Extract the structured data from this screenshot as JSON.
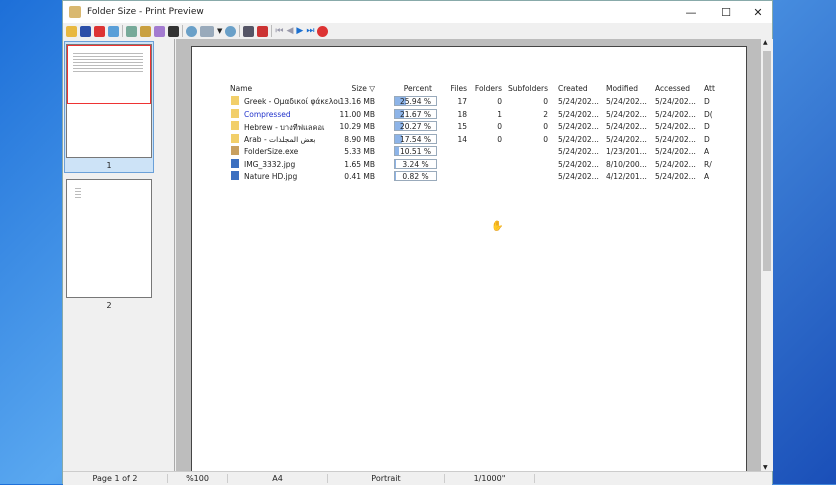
{
  "window": {
    "title": "Folder Size - Print Preview",
    "minimize": "—",
    "maximize": "☐",
    "close": "✕"
  },
  "thumbnails": [
    {
      "label": "1"
    },
    {
      "label": "2"
    }
  ],
  "table": {
    "headers": [
      "Name",
      "Size ▽",
      "Percent",
      "Files",
      "Folders",
      "Subfolders",
      "Created",
      "Modified",
      "Accessed",
      "Att"
    ],
    "rows": [
      {
        "name": "Greek - Ομαδικοί φάκελοι",
        "size": "13.16 MB",
        "percent": "25.94 %",
        "pct": 25.94,
        "files": "17",
        "folders": "0",
        "subfolders": "0",
        "created": "5/24/202...",
        "modified": "5/24/202...",
        "accessed": "5/24/202...",
        "attr": "D",
        "type": "folder"
      },
      {
        "name": "Compressed",
        "size": "11.00 MB",
        "percent": "21.67 %",
        "pct": 21.67,
        "files": "18",
        "folders": "1",
        "subfolders": "2",
        "created": "5/24/202...",
        "modified": "5/24/202...",
        "accessed": "5/24/202...",
        "attr": "D(",
        "type": "folder"
      },
      {
        "name": "Hebrew - บางทีฟแลคอเ",
        "size": "10.29 MB",
        "percent": "20.27 %",
        "pct": 20.27,
        "files": "15",
        "folders": "0",
        "subfolders": "0",
        "created": "5/24/202...",
        "modified": "5/24/202...",
        "accessed": "5/24/202...",
        "attr": "D",
        "type": "folder"
      },
      {
        "name": "Arab - بعض المجلدات",
        "size": "8.90 MB",
        "percent": "17.54 %",
        "pct": 17.54,
        "files": "14",
        "folders": "0",
        "subfolders": "0",
        "created": "5/24/202...",
        "modified": "5/24/202...",
        "accessed": "5/24/202...",
        "attr": "D",
        "type": "folder"
      },
      {
        "name": "FolderSize.exe",
        "size": "5.33 MB",
        "percent": "10.51 %",
        "pct": 10.51,
        "files": "",
        "folders": "",
        "subfolders": "",
        "created": "5/24/202...",
        "modified": "1/23/201...",
        "accessed": "5/24/202...",
        "attr": "A",
        "type": "exe"
      },
      {
        "name": "IMG_3332.jpg",
        "size": "1.65 MB",
        "percent": "3.24 %",
        "pct": 3.24,
        "files": "",
        "folders": "",
        "subfolders": "",
        "created": "5/24/202...",
        "modified": "8/10/200...",
        "accessed": "5/24/202...",
        "attr": "R/",
        "type": "img"
      },
      {
        "name": "Nature HD.jpg",
        "size": "0.41 MB",
        "percent": "0.82 %",
        "pct": 0.82,
        "files": "",
        "folders": "",
        "subfolders": "",
        "created": "5/24/202...",
        "modified": "4/12/201...",
        "accessed": "5/24/202...",
        "attr": "A",
        "type": "img"
      }
    ]
  },
  "status": {
    "page": "Page 1 of 2",
    "zoom": "%100",
    "paper": "A4",
    "orientation": "Portrait",
    "scale": "1/1000\""
  }
}
